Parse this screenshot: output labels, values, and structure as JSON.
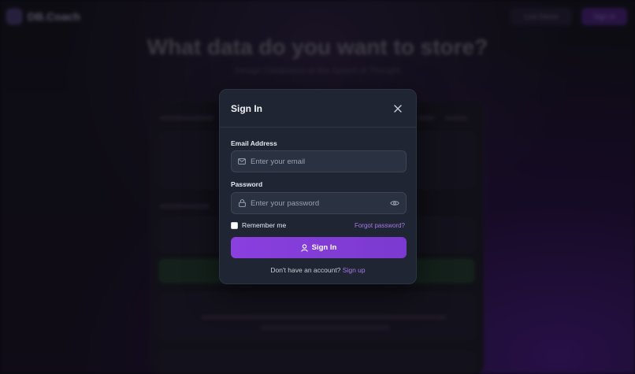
{
  "background": {
    "logo_text": "DB.Coach",
    "live_button": "Live Demo",
    "signin_button": "Sign In",
    "title": "What data do you want to store?",
    "subtitle": "Design Databases at the Speed of Thought"
  },
  "modal": {
    "title": "Sign In",
    "email_label": "Email Address",
    "email_placeholder": "Enter your email",
    "email_value": "",
    "password_label": "Password",
    "password_placeholder": "Enter your password",
    "password_value": "",
    "remember_label": "Remember me",
    "remember_checked": false,
    "forgot_link": "Forgot password?",
    "submit_label": "Sign In",
    "footer_text": "Don't have an account?",
    "signup_link": "Sign up"
  },
  "colors": {
    "accent": "#8a3fde",
    "link": "#a779e6",
    "modal_bg": "#1f2532"
  },
  "icons": {
    "close": "close-icon",
    "email": "mail-icon",
    "password": "lock-icon",
    "reveal": "eye-icon",
    "submit": "user-icon"
  }
}
